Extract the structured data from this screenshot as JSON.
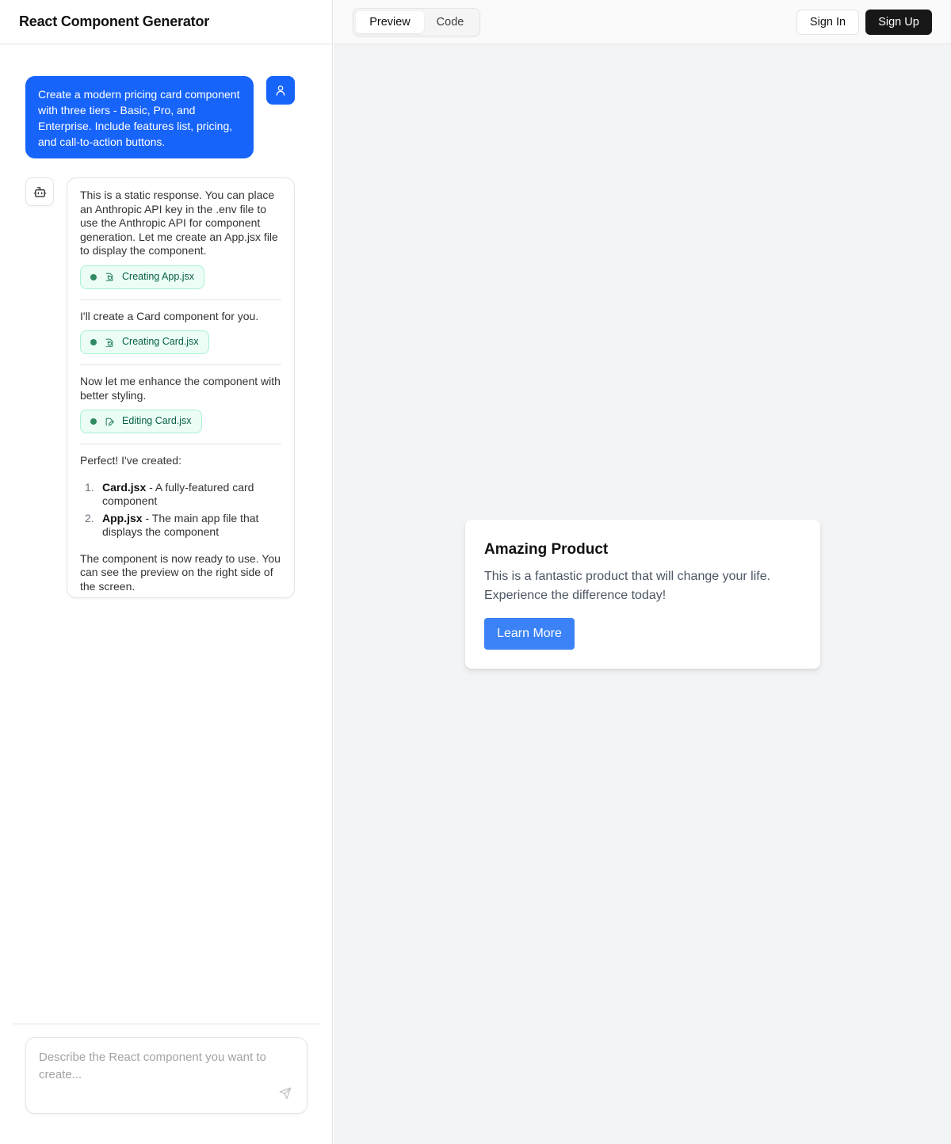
{
  "app": {
    "title": "React Component Generator"
  },
  "chat": {
    "user_message": "Create a modern pricing card component with three tiers - Basic, Pro, and Enterprise. Include features list, pricing, and call-to-action buttons.",
    "assistant": {
      "intro": "This is a static response. You can place an Anthropic API key in the .env file to use the Anthropic API for component generation. Let me create an App.jsx file to display the component.",
      "tool_1": "Creating App.jsx",
      "step_2": "I'll create a Card component for you.",
      "tool_2": "Creating Card.jsx",
      "step_3": "Now let me enhance the component with better styling.",
      "tool_3": "Editing Card.jsx",
      "summary_intro": "Perfect! I've created:",
      "list": [
        {
          "num": "1.",
          "name": "Card.jsx",
          "desc": " - A fully-featured card component"
        },
        {
          "num": "2.",
          "name": "App.jsx",
          "desc": " - The main app file that displays the component"
        }
      ],
      "final": "The component is now ready to use. You can see the preview on the right side of the screen."
    },
    "input": {
      "placeholder": "Describe the React component you want to create...",
      "value": ""
    }
  },
  "toolbar": {
    "tabs": [
      {
        "label": "Preview",
        "active": true
      },
      {
        "label": "Code",
        "active": false
      }
    ],
    "sign_in": "Sign In",
    "sign_up": "Sign Up"
  },
  "preview": {
    "title": "Amazing Product",
    "description": "This is a fantastic product that will change your life. Experience the difference today!",
    "button": "Learn More"
  },
  "colors": {
    "accent": "#1764fb",
    "preview_button": "#3b82f6",
    "tool_pill_bg": "#ecfdf5",
    "tool_pill_border": "#a7f3d0",
    "tool_pill_text": "#065f46",
    "dark_button": "#171717",
    "preview_bg": "#f3f4f6"
  },
  "icons": {
    "user_avatar": "user-icon",
    "bot_avatar": "bot-icon",
    "tool_create": "file-refresh-icon",
    "tool_edit": "file-edit-icon",
    "send": "send-icon"
  }
}
